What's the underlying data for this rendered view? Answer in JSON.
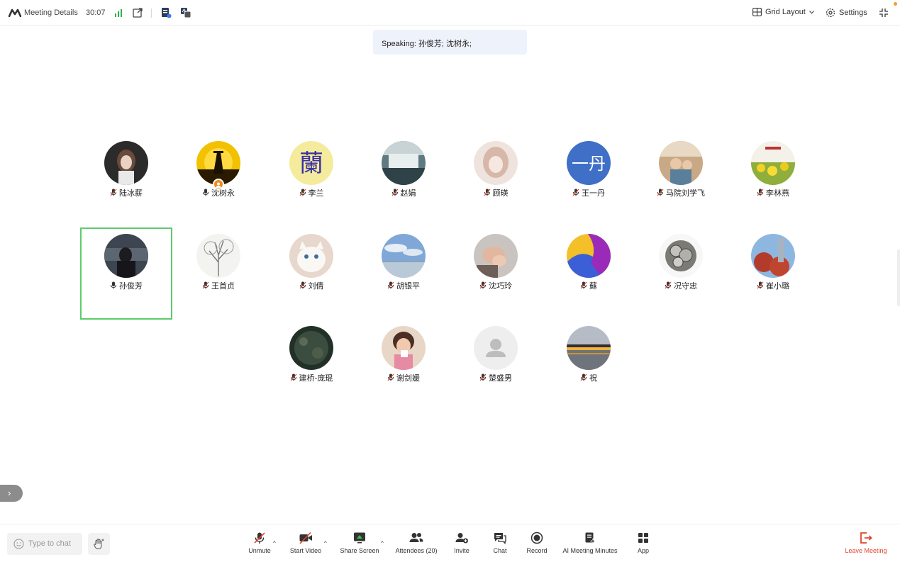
{
  "topbar": {
    "meeting_details": "Meeting Details",
    "timer": "30:07",
    "grid_layout": "Grid Layout",
    "settings": "Settings"
  },
  "speaking": {
    "label": "Speaking:",
    "names": "孙俊芳; 沈树永;"
  },
  "participants": [
    {
      "name": "陆冰薪",
      "muted": true,
      "avatar": "girl-photo"
    },
    {
      "name": "沈树永",
      "muted": false,
      "avatar": "silhouette-sunset",
      "host": true
    },
    {
      "name": "李兰",
      "muted": true,
      "avatar": "orchid-character"
    },
    {
      "name": "赵娟",
      "muted": true,
      "avatar": "waterfall"
    },
    {
      "name": "顾瑛",
      "muted": true,
      "avatar": "anime-girl"
    },
    {
      "name": "王一丹",
      "muted": true,
      "avatar": "initials",
      "initials": "一丹"
    },
    {
      "name": "马院刘学飞",
      "muted": true,
      "avatar": "children-photo"
    },
    {
      "name": "李林燕",
      "muted": true,
      "avatar": "flowers-field"
    },
    {
      "name": "孙俊芳",
      "muted": false,
      "avatar": "dark-portrait",
      "active": true
    },
    {
      "name": "王首贞",
      "muted": true,
      "avatar": "sketch-tree"
    },
    {
      "name": "刘倩",
      "muted": true,
      "avatar": "white-kitten"
    },
    {
      "name": "胡银平",
      "muted": true,
      "avatar": "sky-sea"
    },
    {
      "name": "沈巧玲",
      "muted": true,
      "avatar": "holding-hands"
    },
    {
      "name": "蘇",
      "muted": true,
      "avatar": "abstract-color"
    },
    {
      "name": "况守忠",
      "muted": true,
      "avatar": "gears"
    },
    {
      "name": "崔小璐",
      "muted": true,
      "avatar": "red-blossom"
    },
    {
      "name": "建桥-庞琨",
      "muted": true,
      "avatar": "dark-texture"
    },
    {
      "name": "谢剑媛",
      "muted": true,
      "avatar": "toddler-photo"
    },
    {
      "name": "楚盛男",
      "muted": true,
      "avatar": "default-user"
    },
    {
      "name": "祝",
      "muted": true,
      "avatar": "sunset-lake"
    }
  ],
  "chat": {
    "placeholder": "Type to chat"
  },
  "toolbar": {
    "unmute": "Unmute",
    "start_video": "Start Video",
    "share_screen": "Share Screen",
    "attendees": "Attendees (20)",
    "invite": "Invite",
    "chat": "Chat",
    "record": "Record",
    "ai_minutes": "AI Meeting Minutes",
    "app": "App",
    "leave": "Leave Meeting"
  },
  "colors": {
    "accent_green": "#5ccc6c",
    "leave_red": "#e0452e",
    "banner_bg": "#eef2fb",
    "signal_green": "#2db24c"
  }
}
